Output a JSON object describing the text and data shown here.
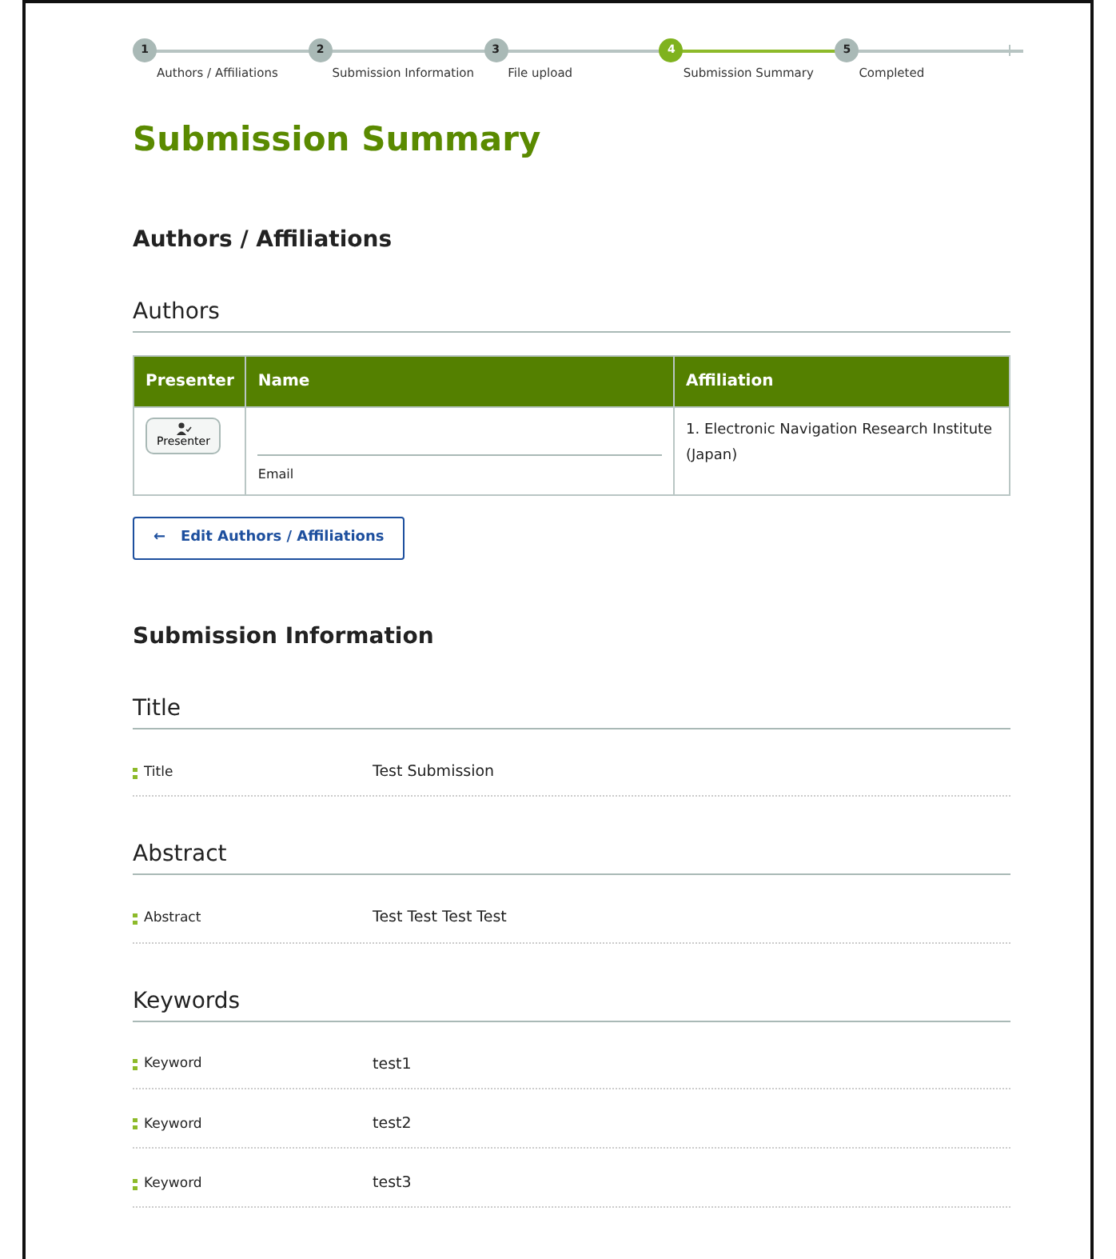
{
  "steps": [
    {
      "number": "1",
      "label": "Authors / Affiliations",
      "selected": false
    },
    {
      "number": "2",
      "label": "Submission Information",
      "selected": false
    },
    {
      "number": "3",
      "label": "File upload",
      "selected": false
    },
    {
      "number": "4",
      "label": "Submission Summary",
      "selected": true
    },
    {
      "number": "5",
      "label": "Completed",
      "selected": false
    }
  ],
  "page_title": "Submission Summary",
  "authors_section": {
    "heading": "Authors / Affiliations",
    "subheading": "Authors",
    "table": {
      "columns": [
        "Presenter",
        "Name",
        "Affiliation"
      ],
      "rows": [
        {
          "presenter_button": "Presenter",
          "name": "",
          "email_label": "Email",
          "affiliation": "1. Electronic Navigation Research Institute (Japan)"
        }
      ]
    },
    "edit_button": {
      "icon": "←",
      "label": "Edit Authors / Affiliations"
    }
  },
  "info_section": {
    "heading": "Submission Information",
    "groups": [
      {
        "heading": "Title",
        "fields": [
          {
            "label": "Title",
            "value": "Test Submission"
          }
        ]
      },
      {
        "heading": "Abstract",
        "fields": [
          {
            "label": "Abstract",
            "value": "Test Test Test Test"
          }
        ]
      },
      {
        "heading": "Keywords",
        "fields": [
          {
            "label": "Keyword",
            "value": "test1"
          },
          {
            "label": "Keyword",
            "value": "test2"
          },
          {
            "label": "Keyword",
            "value": "test3"
          }
        ]
      }
    ]
  }
}
